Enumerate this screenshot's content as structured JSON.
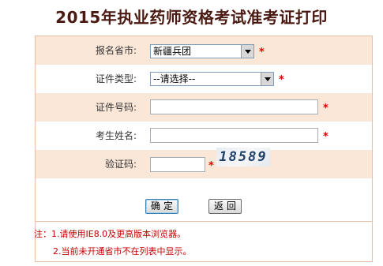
{
  "page": {
    "title": "2015年执业药师资格考试准考证打印"
  },
  "form": {
    "province": {
      "label": "报名省市:",
      "value": "新疆兵团"
    },
    "id_type": {
      "label": "证件类型:",
      "value": "--请选择--"
    },
    "id_number": {
      "label": "证件号码:",
      "value": ""
    },
    "name": {
      "label": "考生姓名:",
      "value": ""
    },
    "captcha": {
      "label": "验证码:",
      "value": "",
      "image_text": "18589"
    },
    "required_mark": "*"
  },
  "buttons": {
    "confirm": "确定",
    "back": "返回"
  },
  "notes": {
    "line1": "注：1.请使用IE8.0及更高版本浏览器。",
    "line2": "2.当前未开通省市不在列表中显示。"
  },
  "colors": {
    "row_alt": "#fbe7d8",
    "border": "#e8c0a8",
    "required": "#e10000",
    "title": "#4a1a12"
  }
}
